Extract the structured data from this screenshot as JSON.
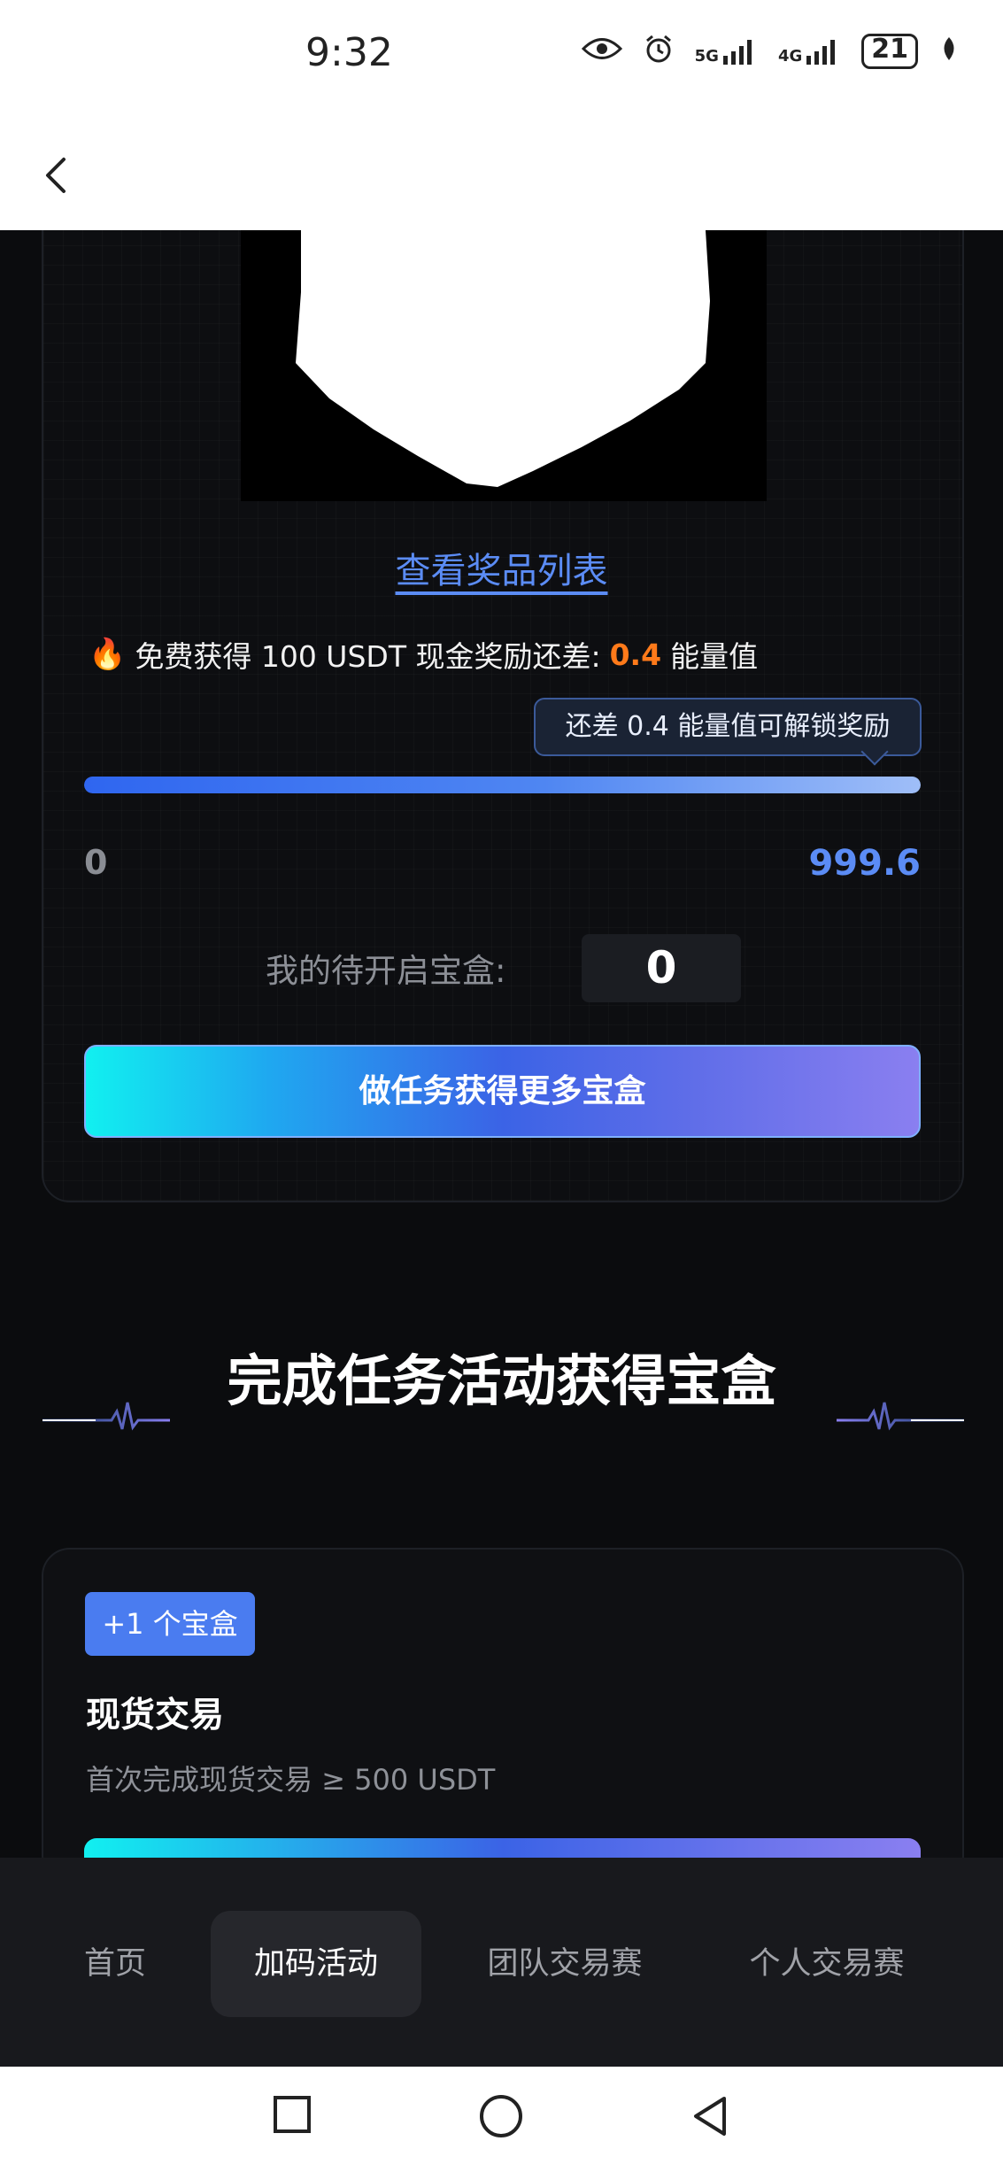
{
  "status_bar": {
    "time": "9:32",
    "network_5g": "5G",
    "network_4g": "4G",
    "battery": "21",
    "icons": [
      "eye-icon",
      "alarm-icon",
      "signal-5g-icon",
      "signal-4g-icon",
      "battery-icon",
      "leaf-icon"
    ]
  },
  "header": {
    "back_icon": "chevron-left-icon"
  },
  "prize": {
    "view_list_link": "查看奖品列表"
  },
  "reward": {
    "prefix": "免费获得 100 USDT 现金奖励还差:",
    "gap_value": "0.4",
    "suffix": "能量值",
    "tooltip": "还差 0.4 能量值可解锁奖励",
    "progress_fraction": 0.9996,
    "progress_min": "0",
    "progress_max": "999.6"
  },
  "boxes": {
    "label": "我的待开启宝盒:",
    "count": "0",
    "cta_label": "做任务获得更多宝盒"
  },
  "section": {
    "title": "完成任务活动获得宝盒"
  },
  "task": {
    "badge": "+1 个宝盒",
    "title": "现货交易",
    "description": "首次完成现货交易 ≥ 500 USDT"
  },
  "tabs": [
    {
      "label": "首页",
      "active": false
    },
    {
      "label": "加码活动",
      "active": true
    },
    {
      "label": "团队交易赛",
      "active": false
    },
    {
      "label": "个人交易赛",
      "active": false
    }
  ],
  "colors": {
    "accent_blue": "#5b8cf5",
    "highlight_orange": "#ff7a1a",
    "background": "#0b0c0e"
  }
}
